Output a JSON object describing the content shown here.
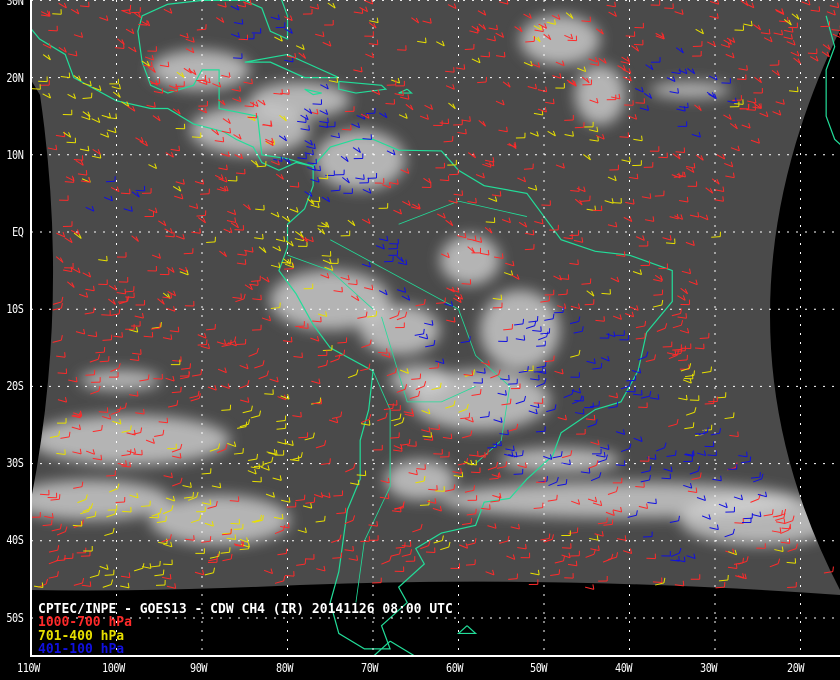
{
  "title": "CPTEC/INPE - GOES13 - CDW CH4 (IR) 20141126 08:00 UTC",
  "legend": [
    {
      "label": "1000-700 hPa",
      "color": "#ff2a2a"
    },
    {
      "label": "701-400 hPa",
      "color": "#e8e000"
    },
    {
      "label": "401-100 hPa",
      "color": "#1010e0"
    }
  ],
  "lat_labels": [
    "30N",
    "20N",
    "10N",
    "EQ",
    "10S",
    "20S",
    "30S",
    "40S",
    "50S"
  ],
  "lon_labels": [
    "110W",
    "100W",
    "90W",
    "80W",
    "70W",
    "60W",
    "50W",
    "40W",
    "30W",
    "20W"
  ],
  "colors": {
    "coastline": "#22dd99",
    "grid": "#ffffff",
    "background": "#000000"
  }
}
